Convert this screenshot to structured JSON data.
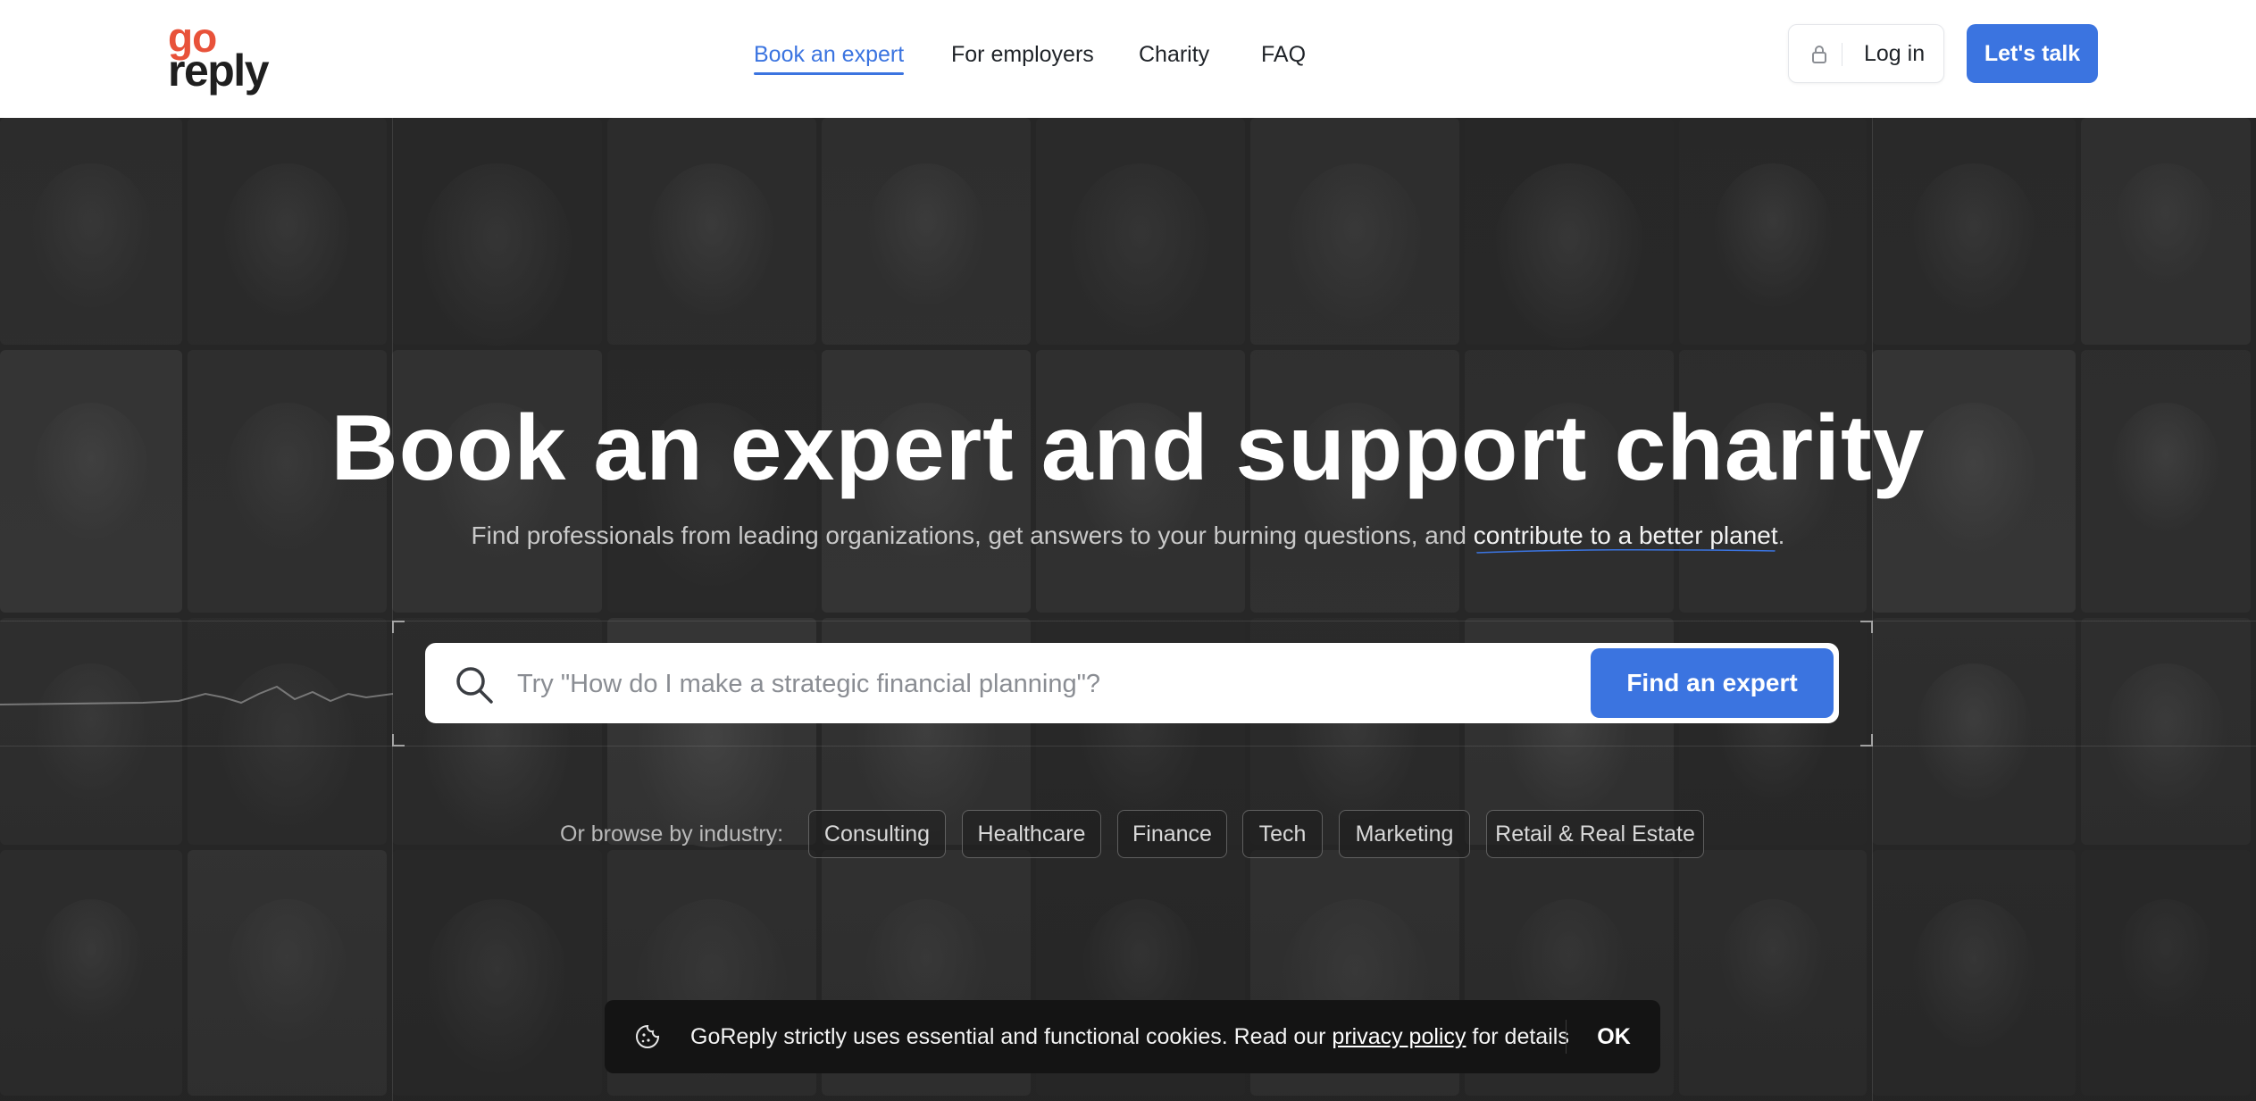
{
  "header": {
    "logo": {
      "line1": "go",
      "line2": "reply"
    },
    "nav": [
      {
        "label": "Book an expert",
        "active": true
      },
      {
        "label": "For employers",
        "active": false
      },
      {
        "label": "Charity",
        "active": false
      },
      {
        "label": "FAQ",
        "active": false
      }
    ],
    "login_label": "Log in",
    "login_icon": "lock-icon",
    "cta_label": "Let's talk"
  },
  "hero": {
    "title": "Book an expert and support charity",
    "subtitle_prefix": "Find professionals from leading organizations, get answers to your burning questions, and ",
    "subtitle_highlight": "contribute to a better planet",
    "subtitle_suffix": "."
  },
  "search": {
    "placeholder": "Try \"How do I make a strategic financial planning\"?",
    "value": "",
    "button_label": "Find an expert",
    "icon": "search-icon"
  },
  "browse": {
    "label": "Or browse by industry:",
    "industries": [
      "Consulting",
      "Healthcare",
      "Finance",
      "Tech",
      "Marketing",
      "Retail & Real Estate"
    ]
  },
  "cookie": {
    "icon": "cookie-icon",
    "text_before": "GoReply strictly uses essential and functional cookies. Read our ",
    "link_label": "privacy policy",
    "text_after": " for details",
    "ok_label": "OK"
  },
  "colors": {
    "accent": "#3b74e0",
    "logo_go": "#e8523a",
    "logo_reply": "#1f1f1f",
    "hero_bg": "#2a2a2a",
    "cookie_bg": "#141414"
  }
}
